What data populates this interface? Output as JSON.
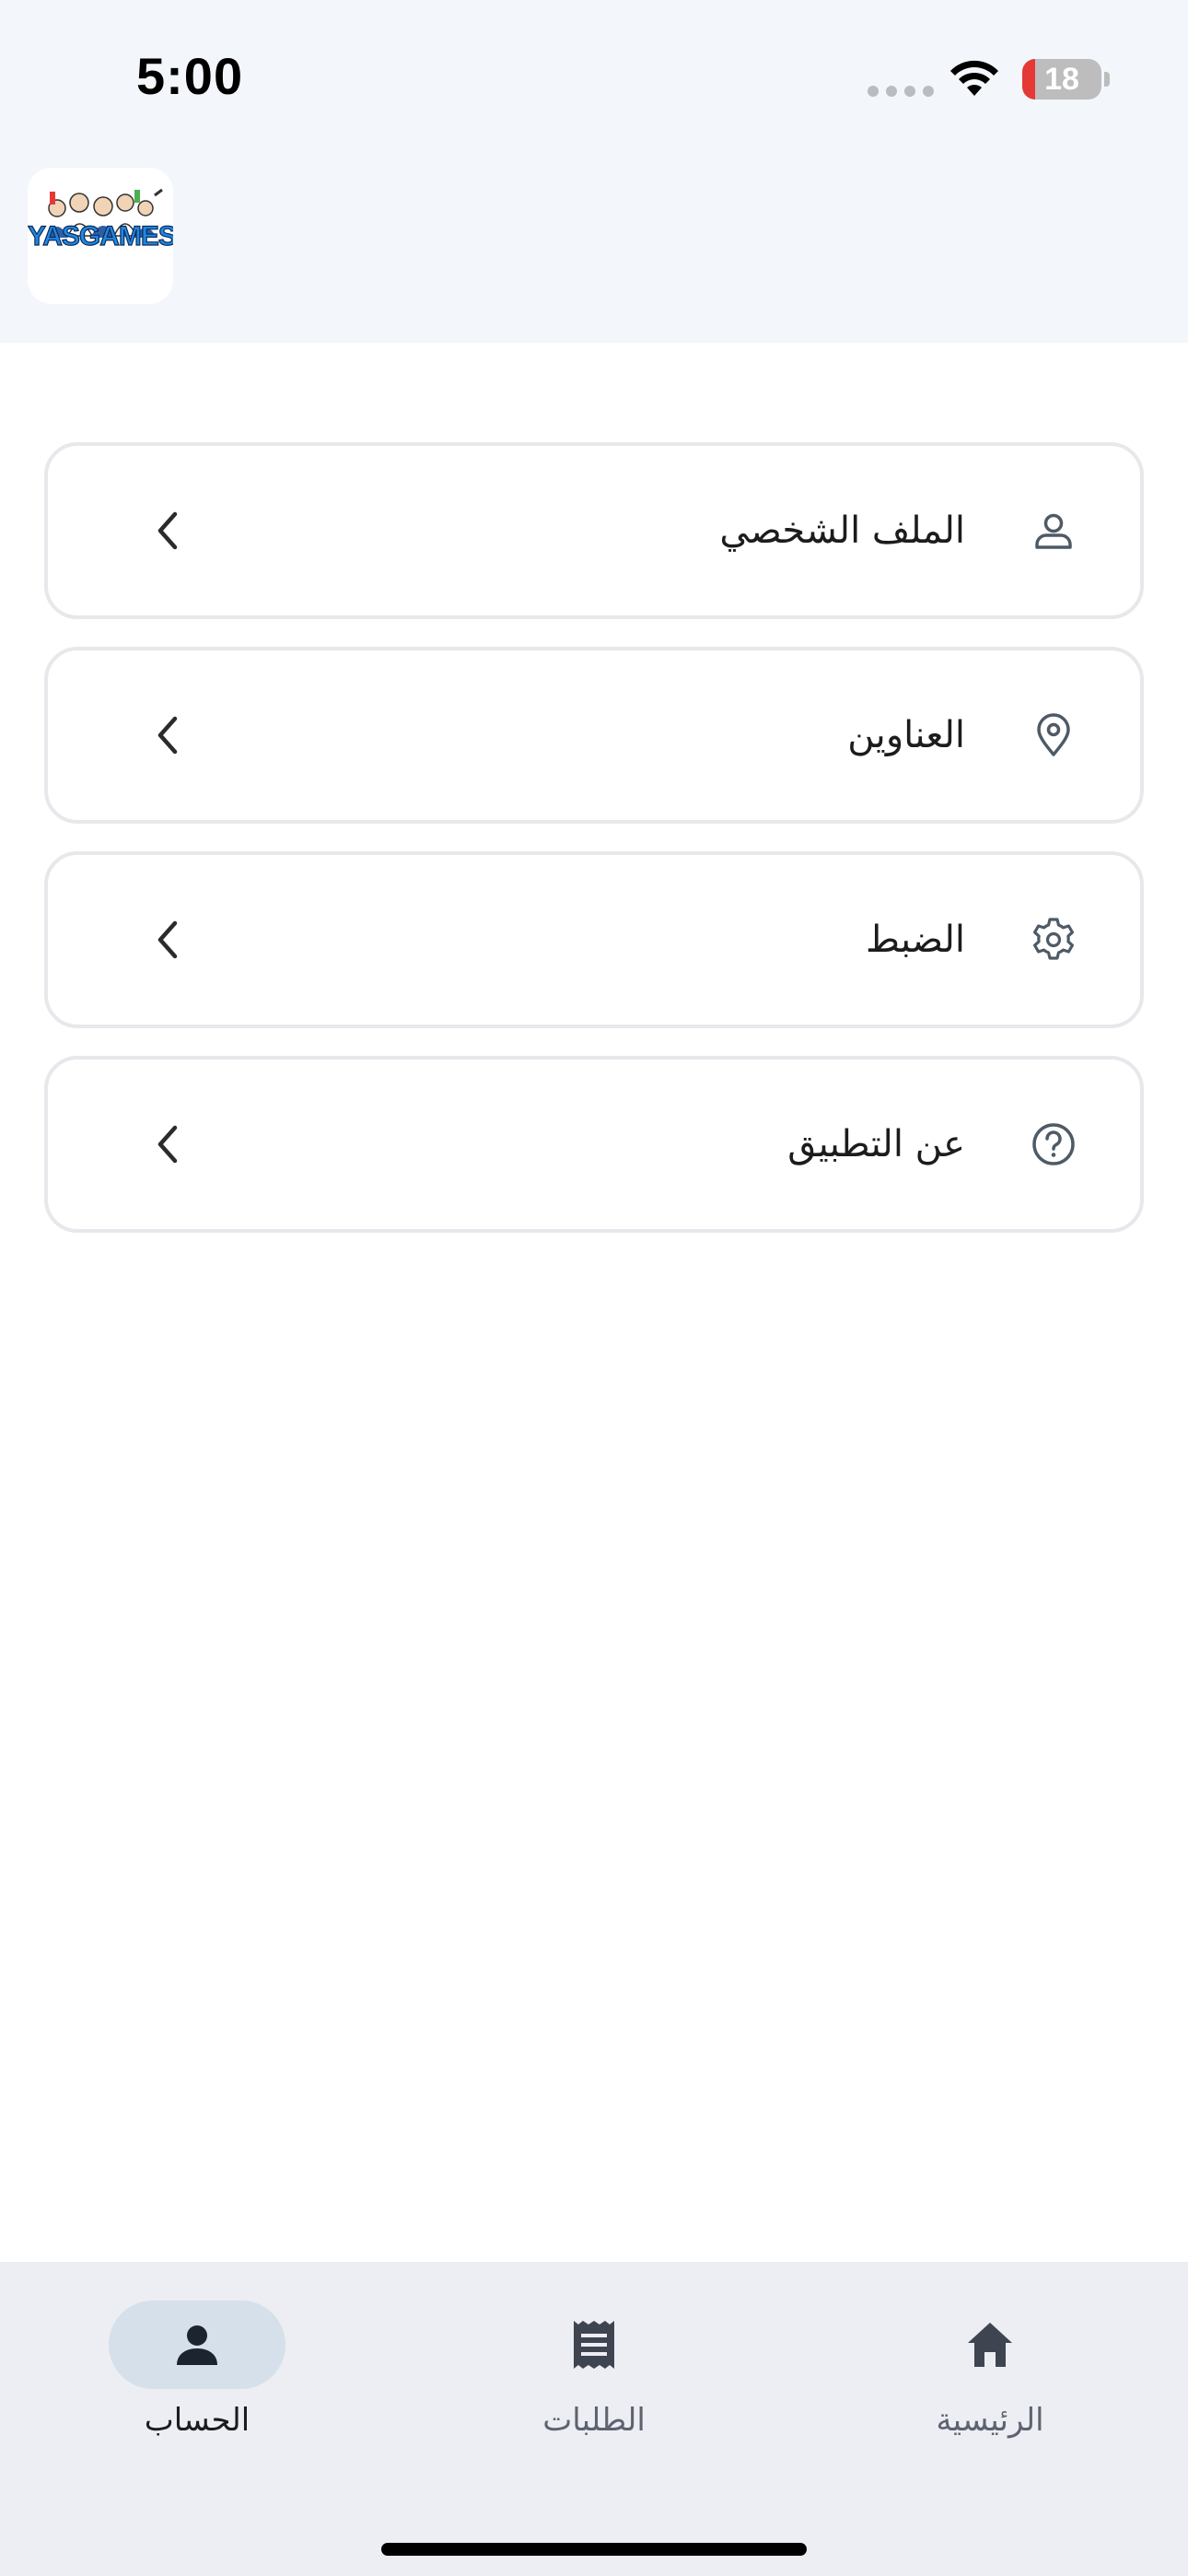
{
  "status_bar": {
    "time": "5:00",
    "battery_level": "18"
  },
  "header": {
    "logo_text": "YASGAMES"
  },
  "menu": {
    "items": [
      {
        "label": "الملف الشخصي",
        "icon": "person-icon"
      },
      {
        "label": "العناوين",
        "icon": "location-pin-icon"
      },
      {
        "label": "الضبط",
        "icon": "gear-icon"
      },
      {
        "label": "عن التطبيق",
        "icon": "help-circle-icon"
      }
    ]
  },
  "bottom_nav": {
    "items": [
      {
        "label": "الحساب",
        "icon": "account-icon",
        "active": true
      },
      {
        "label": "الطلبات",
        "icon": "orders-receipt-icon",
        "active": false
      },
      {
        "label": "الرئيسية",
        "icon": "home-icon",
        "active": false
      }
    ]
  },
  "colors": {
    "header_bg": "#f3f6fb",
    "nav_bg": "#eceef3",
    "active_pill": "#d6e0ea",
    "icon": "#4e5a66",
    "battery_low": "#e53935"
  }
}
